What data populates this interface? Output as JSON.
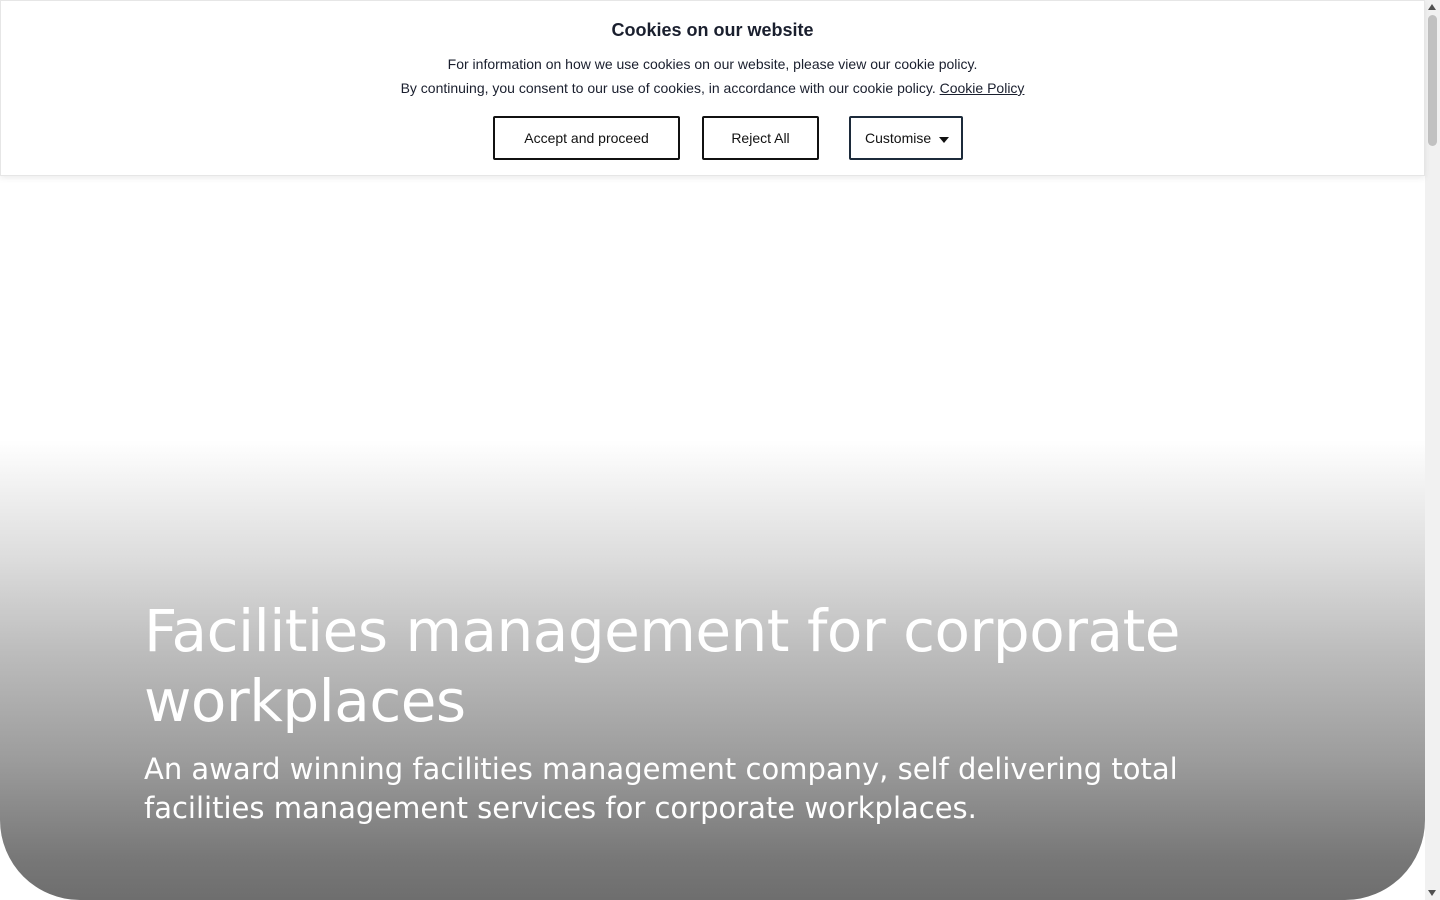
{
  "cookie_banner": {
    "title": "Cookies on our website",
    "line1": "For information on how we use cookies on our website, please view our cookie policy.",
    "line2": "By continuing, you consent to our use of cookies, in accordance with our cookie policy.",
    "policy_link": "Cookie Policy",
    "accept_label": "Accept and proceed",
    "reject_label": "Reject All",
    "customise_label": "Customise"
  },
  "hero": {
    "title": "Facilities management for corporate workplaces",
    "subtitle": "An award winning facilities management company, self delivering total facilities management services for corporate workplaces."
  },
  "icons": {
    "logo": "logo-chevron-icon",
    "customise_caret": "caret-down-icon",
    "scroll_up": "arrow-up-icon",
    "scroll_down": "arrow-down-icon"
  },
  "colors": {
    "banner_text": "#1a1f2e",
    "button_border": "#111111",
    "hero_text": "#ffffff",
    "logo_stroke": "#f1ead3"
  }
}
